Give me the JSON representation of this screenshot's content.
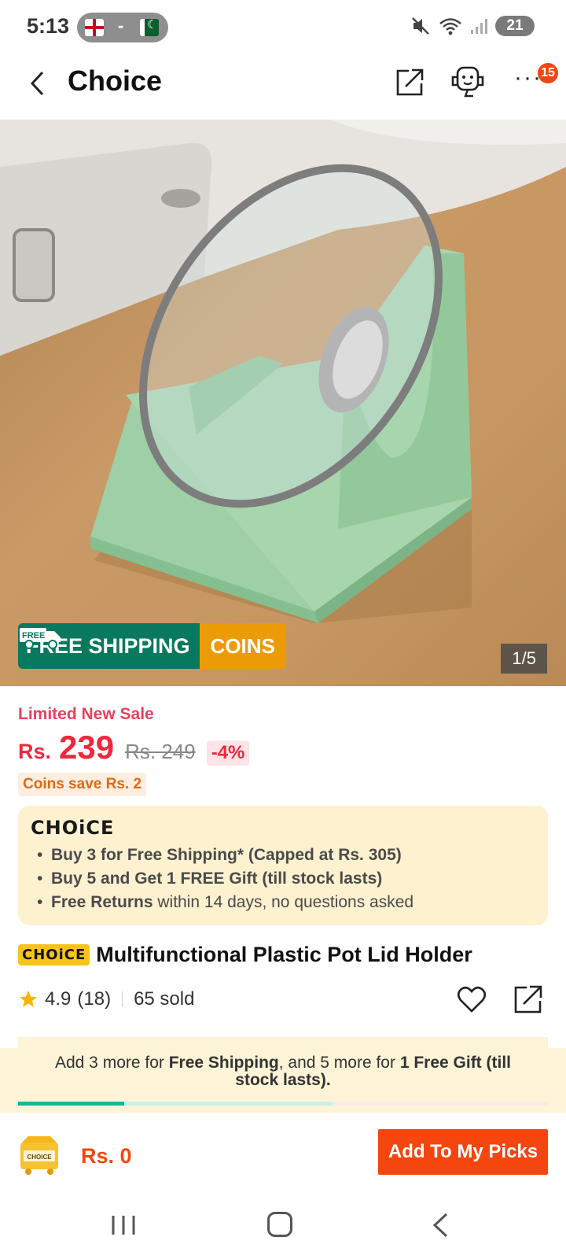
{
  "status_bar": {
    "time": "5:13",
    "separator": "-",
    "battery": "21"
  },
  "header": {
    "title": "Choice",
    "notification_count": "15"
  },
  "hero": {
    "free_shipping": "FREE SHIPPING",
    "free_tag": "FREE",
    "coins": "COINS",
    "counter": "1/5"
  },
  "pricing": {
    "label": "Limited New Sale",
    "currency": "Rs.",
    "price": "239",
    "old_price": "Rs. 249",
    "discount": "-4%",
    "coins_save": "Coins save Rs. 2"
  },
  "choice_card": {
    "logo": "CHOiCE",
    "bullets": [
      {
        "bold": "Buy 3 for  Free Shipping* (Capped at Rs. 305)",
        "rest": ""
      },
      {
        "bold": "Buy 5 and Get 1 FREE Gift (till stock lasts)",
        "rest": ""
      },
      {
        "bold": "Free Returns",
        "rest": " within 14 days, no questions asked"
      }
    ]
  },
  "product": {
    "badge": "CHOiCE",
    "title": "Multifunctional Plastic Pot Lid Holder",
    "rating": "4.9",
    "reviews": "(18)",
    "sold": "65 sold"
  },
  "promo": {
    "part1": "Add 3 more for ",
    "bold1": "Free Shipping",
    "part2": ", and 5 more for ",
    "bold2": "1 Free Gift (till stock lasts).",
    "progress": 0.2
  },
  "action_bar": {
    "box_label": "CHOICE",
    "amount": "Rs. 0",
    "add_button": "Add To My Picks"
  },
  "colors": {
    "accent": "#f5460f",
    "price": "#f0283d",
    "shipping_green": "#08785e",
    "coins_orange": "#ec9a06"
  }
}
